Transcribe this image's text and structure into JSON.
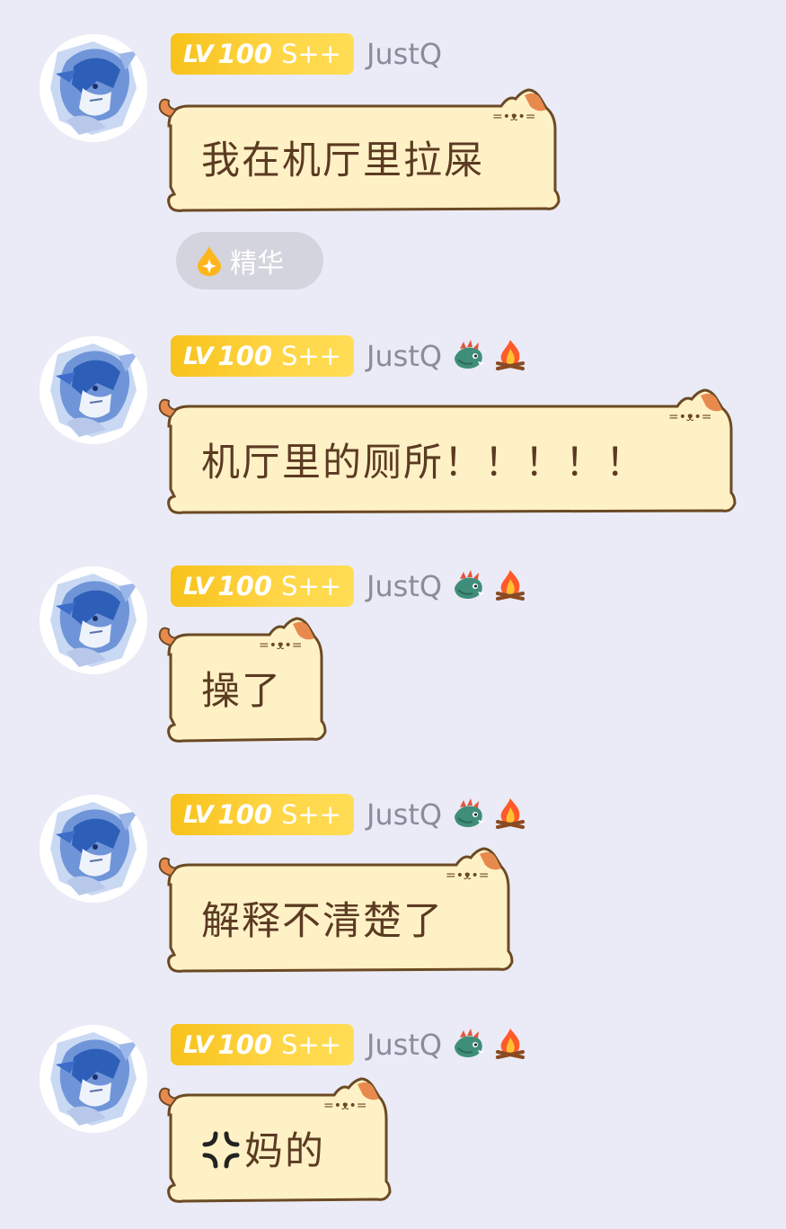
{
  "colors": {
    "background": "#eaebf6",
    "bubble_fill": "#fff1c6",
    "bubble_border": "#6b4a24",
    "bubble_text": "#5b3a22",
    "level_badge": "#ffd02e",
    "username": "#8a8c9c"
  },
  "messages": [
    {
      "level_prefix": "LV",
      "level_number": "100",
      "level_grade": "S++",
      "username": "JustQ",
      "icons": [],
      "text": "我在机厅里拉屎",
      "essence_label": "精华"
    },
    {
      "level_prefix": "LV",
      "level_number": "100",
      "level_grade": "S++",
      "username": "JustQ",
      "icons": [
        "dragon-icon",
        "campfire-icon"
      ],
      "text": "机厅里的厕所！！！！！"
    },
    {
      "level_prefix": "LV",
      "level_number": "100",
      "level_grade": "S++",
      "username": "JustQ",
      "icons": [
        "dragon-icon",
        "campfire-icon"
      ],
      "text": "操了"
    },
    {
      "level_prefix": "LV",
      "level_number": "100",
      "level_grade": "S++",
      "username": "JustQ",
      "icons": [
        "dragon-icon",
        "campfire-icon"
      ],
      "text": "解释不清楚了"
    },
    {
      "level_prefix": "LV",
      "level_number": "100",
      "level_grade": "S++",
      "username": "JustQ",
      "icons": [
        "dragon-icon",
        "campfire-icon"
      ],
      "text_icon": "anger-symbol-icon",
      "text": "妈的"
    }
  ]
}
